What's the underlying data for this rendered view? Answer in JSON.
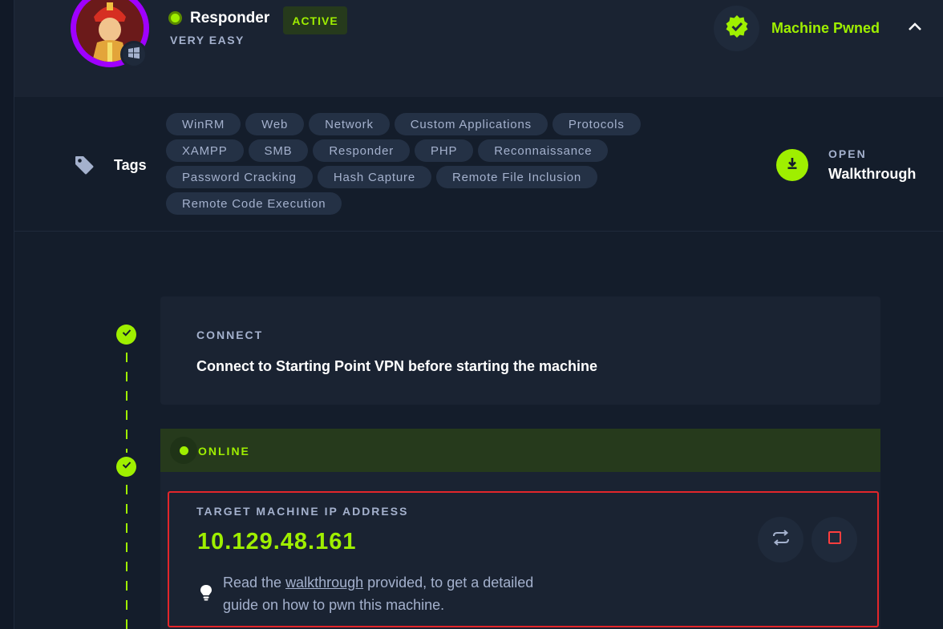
{
  "machine": {
    "name": "Responder",
    "difficulty": "VERY EASY",
    "state_badge": "ACTIVE",
    "pwned_label": "Machine Pwned"
  },
  "tags": {
    "label": "Tags",
    "rows": [
      [
        "WinRM",
        "Web",
        "Network",
        "Custom Applications",
        "Protocols"
      ],
      [
        "XAMPP",
        "SMB",
        "Responder",
        "PHP",
        "Reconnaissance"
      ],
      [
        "Password Cracking",
        "Hash Capture",
        "Remote File Inclusion"
      ],
      [
        "Remote Code Execution"
      ]
    ]
  },
  "walkthrough": {
    "open_label": "OPEN",
    "label": "Walkthrough"
  },
  "connect": {
    "title": "CONNECT",
    "text": "Connect to Starting Point VPN before starting the machine"
  },
  "online": {
    "label": "ONLINE"
  },
  "target": {
    "title": "TARGET MACHINE IP ADDRESS",
    "ip": "10.129.48.161",
    "hint_before": "Read the ",
    "hint_link": "walkthrough",
    "hint_after": " provided, to get a detailed guide on how to pwn this machine."
  },
  "colors": {
    "accent": "#9fef00",
    "background": "#141d2b",
    "card": "#1a2332",
    "highlight": "#e3262b",
    "avatar_ring": "#9f00ff"
  },
  "icons": [
    "windows-icon",
    "verified-check-icon",
    "chevron-up-icon",
    "tag-icon",
    "download-icon",
    "check-icon",
    "lightbulb-icon",
    "reset-icon",
    "stop-icon"
  ]
}
